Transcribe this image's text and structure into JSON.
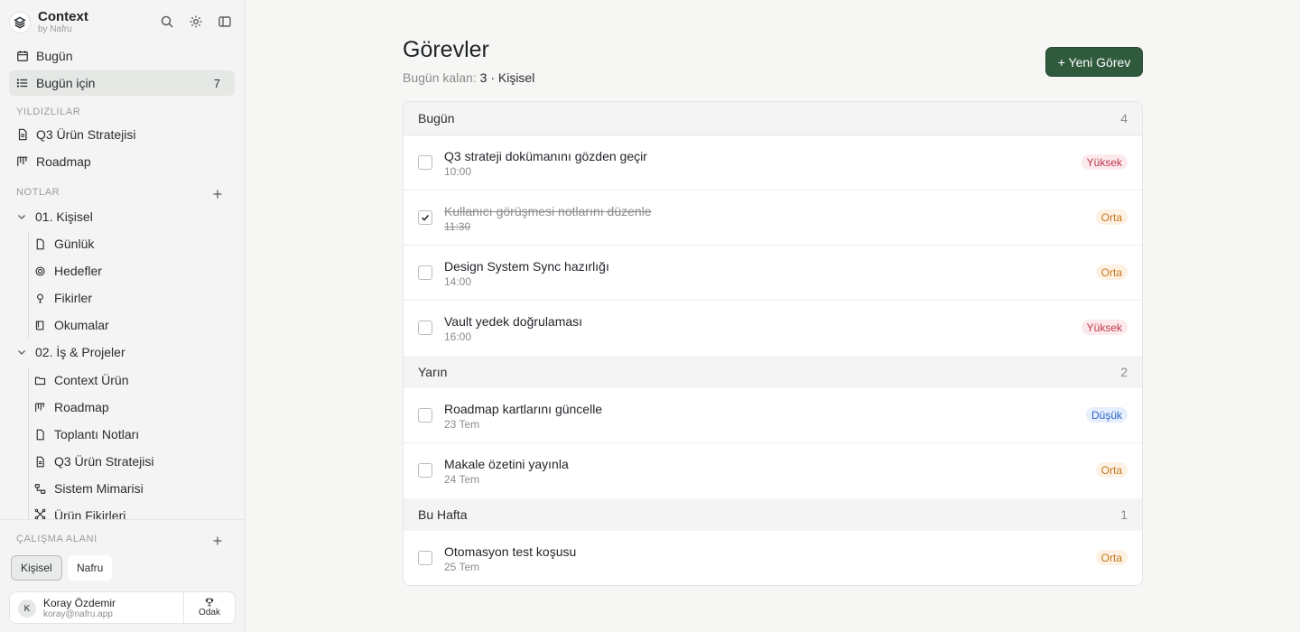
{
  "app": {
    "name": "Context",
    "byline": "by Nafru"
  },
  "sidebar": {
    "nav": [
      {
        "label": "Bugün",
        "icon": "calendar-icon"
      },
      {
        "label": "Bugün için",
        "icon": "list-icon",
        "count": "7"
      }
    ],
    "starred_label": "YILDIZLILAR",
    "starred": [
      {
        "label": "Q3 Ürün Stratejisi",
        "icon": "document-icon"
      },
      {
        "label": "Roadmap",
        "icon": "kanban-icon"
      }
    ],
    "notes_label": "NOTLAR",
    "folders": [
      {
        "label": "01. Kişisel",
        "children": [
          {
            "label": "Günlük",
            "icon": "file-icon"
          },
          {
            "label": "Hedefler",
            "icon": "target-icon"
          },
          {
            "label": "Fikirler",
            "icon": "lightbulb-icon"
          },
          {
            "label": "Okumalar",
            "icon": "book-icon"
          }
        ]
      },
      {
        "label": "02. İş & Projeler",
        "children": [
          {
            "label": "Context Ürün",
            "icon": "folder-icon"
          },
          {
            "label": "Roadmap",
            "icon": "kanban-icon"
          },
          {
            "label": "Toplantı Notları",
            "icon": "file-icon"
          },
          {
            "label": "Q3 Ürün Stratejisi",
            "icon": "document-icon"
          },
          {
            "label": "Sistem Mimarisi",
            "icon": "diagram-icon"
          },
          {
            "label": "Ürün Fikirleri",
            "icon": "nodes-icon"
          }
        ]
      }
    ],
    "workspace_label": "ÇALIŞMA ALANI",
    "workspaces": [
      "Kişisel",
      "Nafru"
    ],
    "user": {
      "initial": "K",
      "name": "Koray Özdemir",
      "email": "koray@nafru.app",
      "focus_label": "Odak"
    }
  },
  "main": {
    "title": "Görevler",
    "subtitle_prefix": "Bugün kalan:",
    "remaining": "3",
    "separator": "·",
    "scope": "Kişisel",
    "new_button": "+ Yeni Görev",
    "groups": [
      {
        "name": "Bugün",
        "count": "4",
        "tasks": [
          {
            "title": "Q3 strateji dokümanını gözden geçir",
            "time": "10:00",
            "priority": "Yüksek",
            "level": "high",
            "done": false
          },
          {
            "title": "Kullanıcı görüşmesi notlarını düzenle",
            "time": "11:30",
            "priority": "Orta",
            "level": "mid",
            "done": true
          },
          {
            "title": "Design System Sync hazırlığı",
            "time": "14:00",
            "priority": "Orta",
            "level": "mid",
            "done": false
          },
          {
            "title": "Vault yedek doğrulaması",
            "time": "16:00",
            "priority": "Yüksek",
            "level": "high",
            "done": false
          }
        ]
      },
      {
        "name": "Yarın",
        "count": "2",
        "tasks": [
          {
            "title": "Roadmap kartlarını güncelle",
            "time": "23 Tem",
            "priority": "Düşük",
            "level": "low",
            "done": false
          },
          {
            "title": "Makale özetini yayınla",
            "time": "24 Tem",
            "priority": "Orta",
            "level": "mid",
            "done": false
          }
        ]
      },
      {
        "name": "Bu Hafta",
        "count": "1",
        "tasks": [
          {
            "title": "Otomasyon test koşusu",
            "time": "25 Tem",
            "priority": "Orta",
            "level": "mid",
            "done": false
          }
        ]
      }
    ]
  }
}
